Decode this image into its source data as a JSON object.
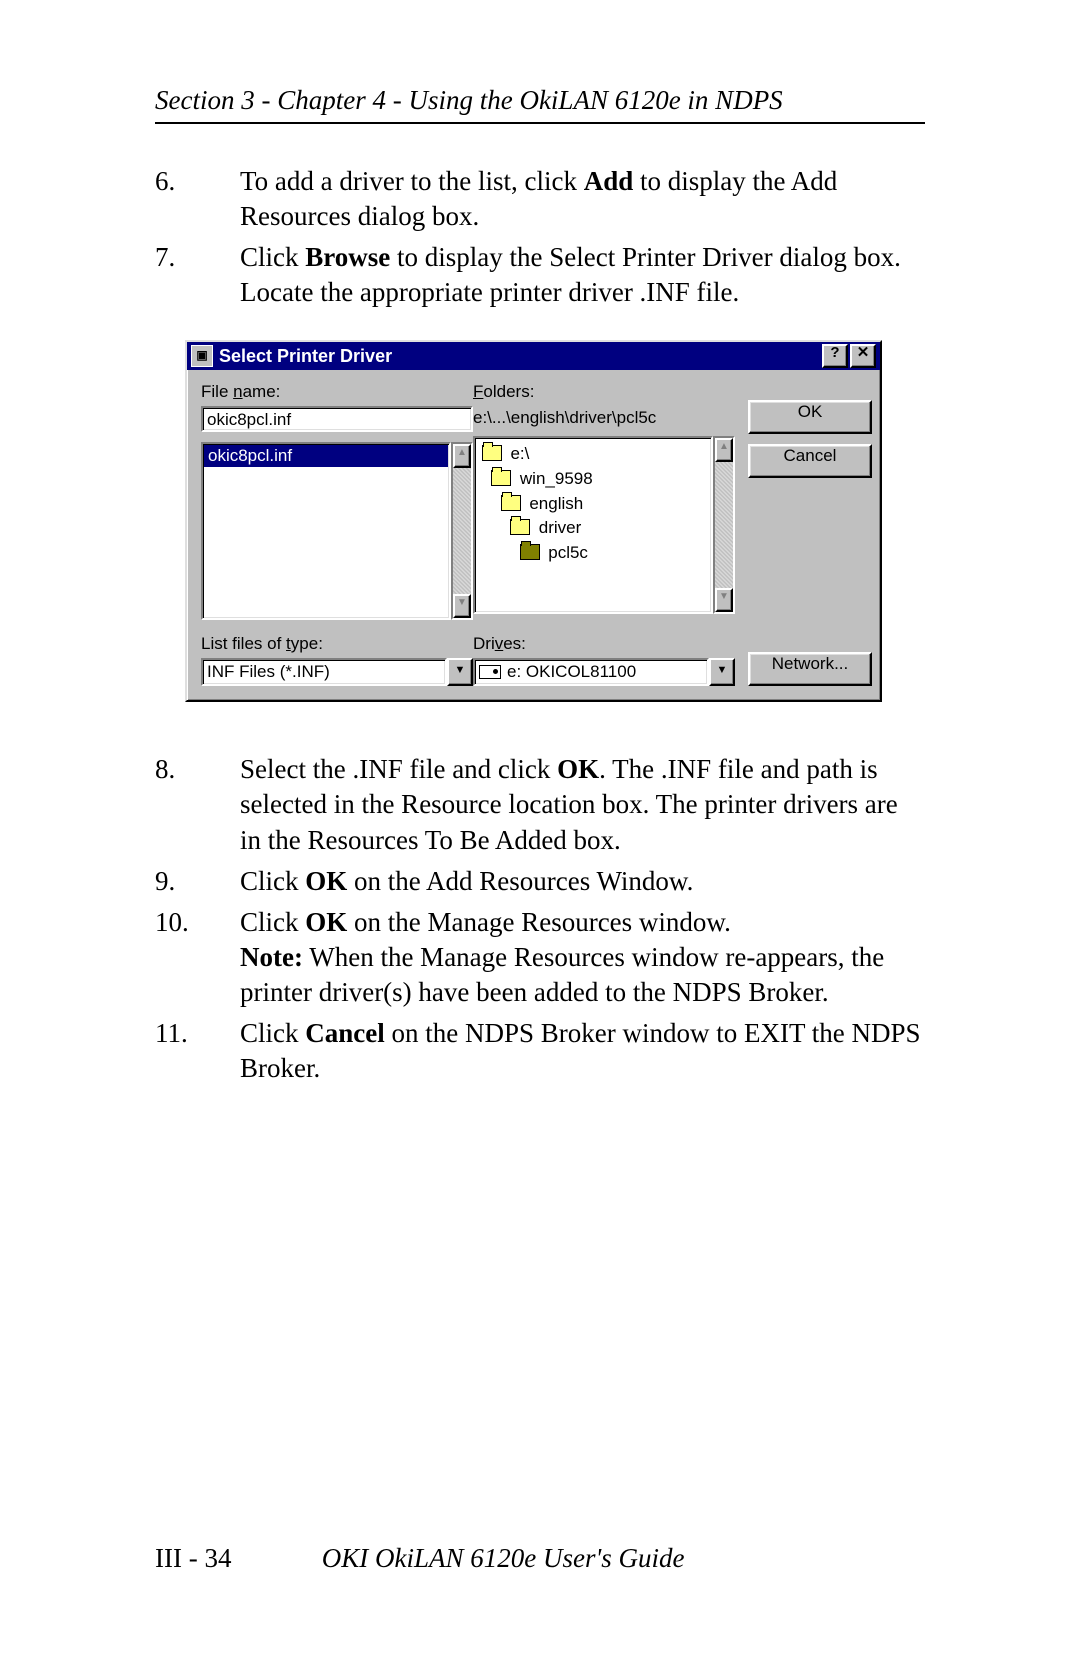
{
  "header": "Section 3 - Chapter 4 - Using the OkiLAN 6120e in NDPS",
  "steps_top": [
    {
      "num": "6.",
      "pre": "To add a driver to the list, click ",
      "bold": "Add",
      "post": " to display the Add Resources dialog box."
    },
    {
      "num": "7.",
      "pre": "Click ",
      "bold": "Browse",
      "post": " to display the Select Printer Driver dialog box. Locate the appropriate printer driver .INF file."
    }
  ],
  "dialog": {
    "title": "Select Printer Driver",
    "labels": {
      "file_name": "File name:",
      "file_name_u_idx": 5,
      "folders": "Folders:",
      "folders_u_idx": 0,
      "list_type": "List files of type:",
      "list_type_u_idx": 14,
      "drives": "Drives:",
      "drives_u_idx": 3
    },
    "file_name_value": "okic8pcl.inf",
    "file_list_selected": "okic8pcl.inf",
    "folder_path": "e:\\...\\english\\driver\\pcl5c",
    "folder_tree": [
      {
        "indent": 0,
        "name": "e:\\",
        "open": true
      },
      {
        "indent": 1,
        "name": "win_9598",
        "open": true
      },
      {
        "indent": 2,
        "name": "english",
        "open": true
      },
      {
        "indent": 3,
        "name": "driver",
        "open": true
      },
      {
        "indent": 4,
        "name": "pcl5c",
        "open": false
      }
    ],
    "list_type_value": "INF Files (*.INF)",
    "drive_value": "e: OKICOL81100",
    "buttons": {
      "ok": "OK",
      "cancel": "Cancel",
      "network": "Network...",
      "help": "?",
      "close": "✕"
    }
  },
  "steps_bottom": [
    {
      "num": "8.",
      "segments": [
        {
          "t": "Select the .INF file and click "
        },
        {
          "t": "OK",
          "b": true
        },
        {
          "t": ". The .INF file and path is selected in the Resource location box. The printer drivers are in the Resources To Be Added box."
        }
      ]
    },
    {
      "num": "9.",
      "segments": [
        {
          "t": "Click "
        },
        {
          "t": "OK",
          "b": true
        },
        {
          "t": " on the Add Resources Window."
        }
      ]
    },
    {
      "num": "10.",
      "segments": [
        {
          "t": "Click "
        },
        {
          "t": "OK",
          "b": true
        },
        {
          "t": " on the Manage Resources window."
        }
      ],
      "note_segments": [
        {
          "t": "Note:",
          "b": true
        },
        {
          "t": " When the Manage Resources window re-appears, the printer driver(s) have been added to the NDPS Broker."
        }
      ]
    },
    {
      "num": "11.",
      "segments": [
        {
          "t": "Click "
        },
        {
          "t": "Cancel",
          "b": true
        },
        {
          "t": " on the NDPS Broker window to EXIT the NDPS Broker."
        }
      ]
    }
  ],
  "footer": {
    "page": "III - 34",
    "title": "OKI OkiLAN 6120e User's Guide"
  }
}
